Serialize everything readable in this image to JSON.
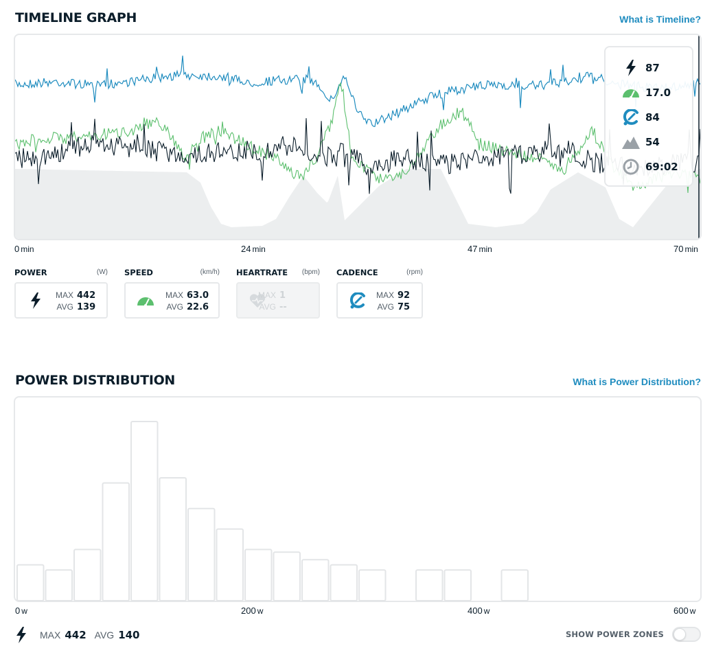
{
  "timeline": {
    "title": "TIMELINE GRAPH",
    "help_link": "What is Timeline?",
    "x_ticks": [
      {
        "value": "0",
        "unit": "min"
      },
      {
        "value": "24",
        "unit": "min"
      },
      {
        "value": "47",
        "unit": "min"
      },
      {
        "value": "70",
        "unit": "min"
      }
    ],
    "tooltip": {
      "power": "87",
      "speed": "17.0",
      "cadence": "84",
      "elevation": "54",
      "time": "69:02"
    },
    "colors": {
      "power": "#0b1d2a",
      "speed": "#5cbf6e",
      "cadence": "#1f8cbf",
      "elevation": "#e9ebec"
    }
  },
  "stats": {
    "power": {
      "name": "POWER",
      "unit": "(W)",
      "max_label": "MAX",
      "max": "442",
      "avg_label": "AVG",
      "avg": "139"
    },
    "speed": {
      "name": "SPEED",
      "unit": "(km/h)",
      "max_label": "MAX",
      "max": "63.0",
      "avg_label": "AVG",
      "avg": "22.6"
    },
    "heartrate": {
      "name": "HEARTRATE",
      "unit": "(bpm)",
      "max_label": "MAX",
      "max": "1",
      "avg_label": "AVG",
      "avg": "--"
    },
    "cadence": {
      "name": "CADENCE",
      "unit": "(rpm)",
      "max_label": "MAX",
      "max": "92",
      "avg_label": "AVG",
      "avg": "75"
    }
  },
  "distribution": {
    "title": "POWER DISTRIBUTION",
    "help_link": "What is Power Distribution?",
    "x_ticks": [
      {
        "value": "0",
        "unit": "w"
      },
      {
        "value": "200",
        "unit": "w"
      },
      {
        "value": "400",
        "unit": "w"
      },
      {
        "value": "600",
        "unit": "w"
      }
    ],
    "footer": {
      "max_label": "MAX",
      "max": "442",
      "avg_label": "AVG",
      "avg": "140"
    },
    "zones_label": "SHOW POWER ZONES"
  },
  "chart_data": {
    "type": "bar",
    "x_unit": "w",
    "xlim": [
      0,
      600
    ],
    "bin_width": 25,
    "bins": [
      0,
      25,
      50,
      75,
      100,
      125,
      150,
      175,
      200,
      225,
      250,
      275,
      300,
      325,
      350,
      375,
      400,
      425
    ],
    "values": [
      14,
      12,
      20,
      46,
      70,
      48,
      36,
      28,
      20,
      19,
      16,
      14,
      12,
      0,
      12,
      12,
      0,
      12
    ]
  }
}
